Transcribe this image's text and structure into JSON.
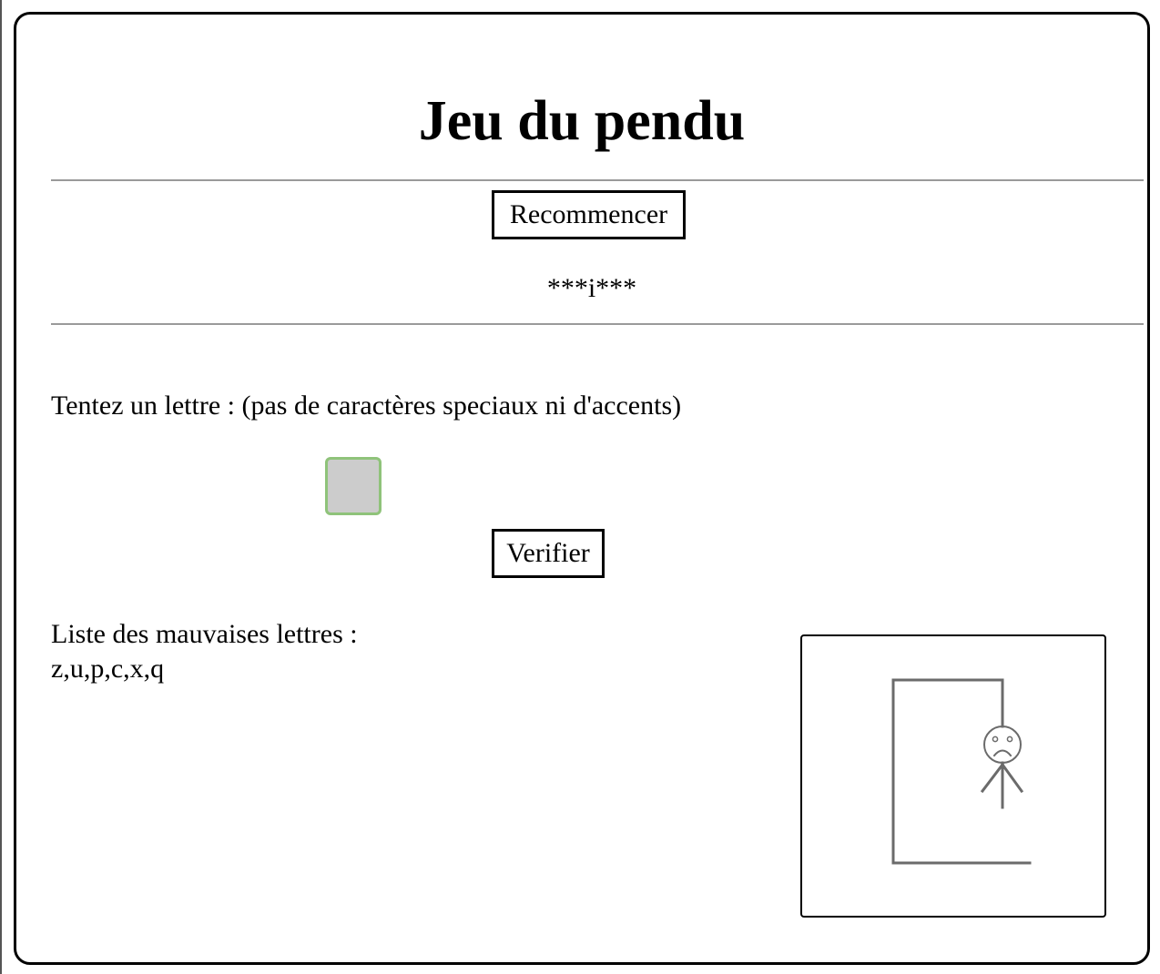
{
  "header": {
    "title": "Jeu du pendu"
  },
  "controls": {
    "restart_label": "Recommencer",
    "verify_label": "Verifier"
  },
  "game": {
    "masked_word": "***i***",
    "prompt": "Tentez un lettre : (pas de caractères speciaux ni d'accents)",
    "letter_input_value": "",
    "wrong_letters_label": "Liste des mauvaises lettres :",
    "wrong_letters": "z,u,p,c,x,q"
  },
  "drawing": {
    "stroke_color": "#6b6b6b",
    "parts_shown": [
      "base",
      "pole",
      "beam",
      "rope",
      "head",
      "sad-face",
      "body",
      "left-arm",
      "right-arm"
    ]
  },
  "colors": {
    "input_border": "#8fc37a",
    "input_background": "#cccccc",
    "divider": "#9a9a9a"
  }
}
